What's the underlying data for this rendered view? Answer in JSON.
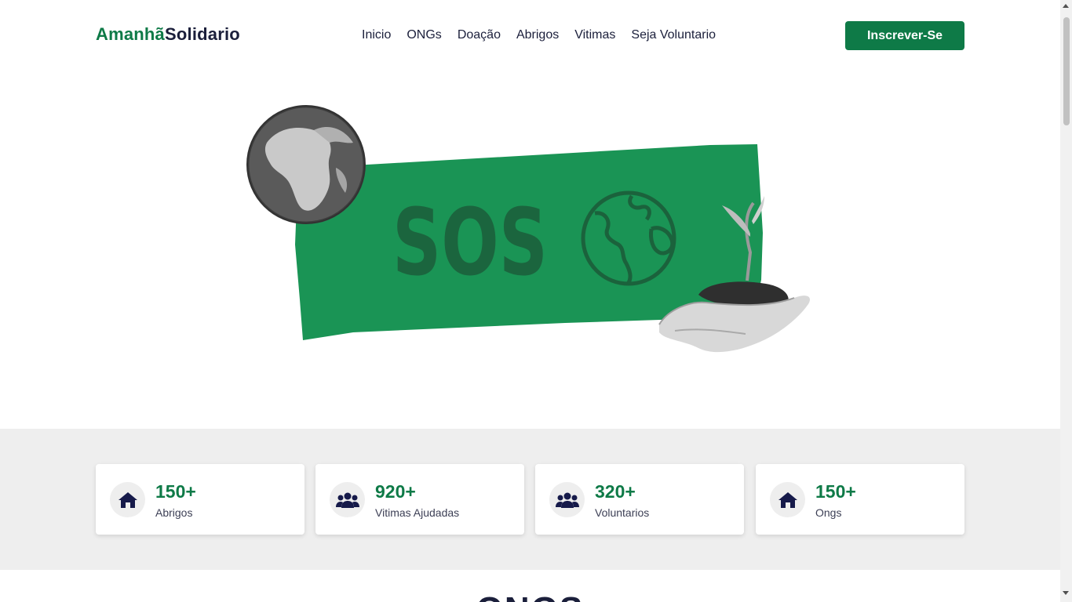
{
  "brand": {
    "part1": "Amanhã",
    "part2": "Solidario"
  },
  "nav": {
    "items": [
      {
        "label": "Inicio"
      },
      {
        "label": "ONGs"
      },
      {
        "label": "Doação"
      },
      {
        "label": "Abrigos"
      },
      {
        "label": "Vitimas"
      },
      {
        "label": "Seja Voluntario"
      }
    ]
  },
  "header": {
    "cta_label": "Inscrever-Se"
  },
  "hero": {
    "sos_text": "SOS"
  },
  "stats": [
    {
      "value": "150+",
      "label": "Abrigos",
      "icon": "house-icon"
    },
    {
      "value": "920+",
      "label": "Vitimas Ajudadas",
      "icon": "people-group-icon"
    },
    {
      "value": "320+",
      "label": "Voluntarios",
      "icon": "people-group-icon"
    },
    {
      "value": "150+",
      "label": "Ongs",
      "icon": "house-icon"
    }
  ],
  "next_section": {
    "title": "ONGS"
  },
  "colors": {
    "brand_green": "#0e7a47",
    "hero_green": "#1a9455",
    "navy": "#1b1f3b",
    "stats_bg": "#eeeeee"
  }
}
